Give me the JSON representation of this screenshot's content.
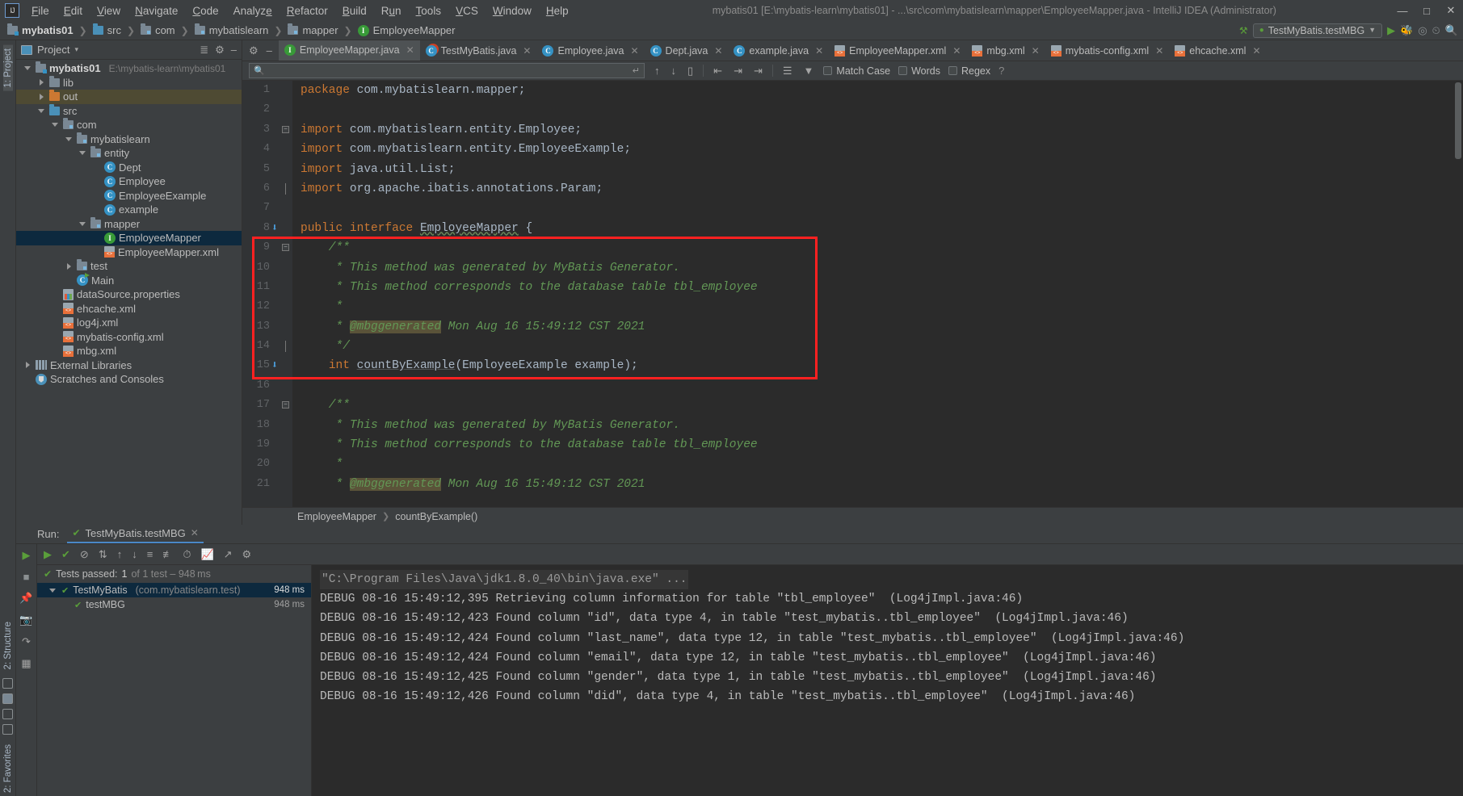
{
  "window": {
    "title": "mybatis01 [E:\\mybatis-learn\\mybatis01] - ...\\src\\com\\mybatislearn\\mapper\\EmployeeMapper.java - IntelliJ IDEA (Administrator)",
    "logo": "IJ",
    "minimize": "—",
    "maximize": "□",
    "close": "✕"
  },
  "menu": [
    {
      "label": "File"
    },
    {
      "label": "Edit"
    },
    {
      "label": "View"
    },
    {
      "label": "Navigate"
    },
    {
      "label": "Code"
    },
    {
      "label": "Analyze"
    },
    {
      "label": "Refactor"
    },
    {
      "label": "Build"
    },
    {
      "label": "Run"
    },
    {
      "label": "Tools"
    },
    {
      "label": "VCS"
    },
    {
      "label": "Window"
    },
    {
      "label": "Help"
    }
  ],
  "breadcrumb": [
    {
      "label": "mybatis01",
      "icon": "module-icon"
    },
    {
      "label": "src",
      "icon": "folder-icon"
    },
    {
      "label": "com",
      "icon": "package-icon"
    },
    {
      "label": "mybatislearn",
      "icon": "package-icon"
    },
    {
      "label": "mapper",
      "icon": "package-icon"
    },
    {
      "label": "EmployeeMapper",
      "icon": "interface-icon"
    }
  ],
  "navbar_right": {
    "run_config": "TestMyBatis.testMBG",
    "run_icon": "run-icon",
    "debug_icon": "debug-icon",
    "coverage_icon": "coverage-icon",
    "profile_icon": "profile-icon",
    "search_icon": "search-everywhere-icon",
    "hammer_icon": "build-icon"
  },
  "project_panel": {
    "title": "Project",
    "chevron": "▾",
    "collapse_icon": "collapse-all-icon",
    "settings_icon": "gear-icon",
    "hide_icon": "hide-icon",
    "tree": [
      {
        "label": "mybatis01",
        "path": "E:\\mybatis-learn\\mybatis01",
        "icon": "module-icon",
        "indent": 0,
        "twisty": "down",
        "bold": true
      },
      {
        "label": "lib",
        "icon": "folder-icon",
        "indent": 1,
        "twisty": "right"
      },
      {
        "label": "out",
        "icon": "folder-orange-icon",
        "indent": 1,
        "twisty": "right",
        "highlight": true
      },
      {
        "label": "src",
        "icon": "folder-blue-icon",
        "indent": 1,
        "twisty": "down"
      },
      {
        "label": "com",
        "icon": "package-icon",
        "indent": 2,
        "twisty": "down"
      },
      {
        "label": "mybatislearn",
        "icon": "package-icon",
        "indent": 3,
        "twisty": "down"
      },
      {
        "label": "entity",
        "icon": "package-icon",
        "indent": 4,
        "twisty": "down"
      },
      {
        "label": "Dept",
        "icon": "class-icon",
        "indent": 5,
        "twisty": ""
      },
      {
        "label": "Employee",
        "icon": "class-icon",
        "indent": 5,
        "twisty": ""
      },
      {
        "label": "EmployeeExample",
        "icon": "class-icon",
        "indent": 5,
        "twisty": ""
      },
      {
        "label": "example",
        "icon": "class-icon",
        "indent": 5,
        "twisty": ""
      },
      {
        "label": "mapper",
        "icon": "package-icon",
        "indent": 4,
        "twisty": "down"
      },
      {
        "label": "EmployeeMapper",
        "icon": "interface-icon",
        "indent": 5,
        "twisty": "",
        "selected": true
      },
      {
        "label": "EmployeeMapper.xml",
        "icon": "xml-icon",
        "indent": 5,
        "twisty": ""
      },
      {
        "label": "test",
        "icon": "package-icon",
        "indent": 3,
        "twisty": "right"
      },
      {
        "label": "Main",
        "icon": "runnable-class-icon",
        "indent": 3,
        "twisty": ""
      },
      {
        "label": "dataSource.properties",
        "icon": "properties-icon",
        "indent": 2,
        "twisty": ""
      },
      {
        "label": "ehcache.xml",
        "icon": "xml-icon",
        "indent": 2,
        "twisty": ""
      },
      {
        "label": "log4j.xml",
        "icon": "xml-icon",
        "indent": 2,
        "twisty": ""
      },
      {
        "label": "mybatis-config.xml",
        "icon": "xml-icon",
        "indent": 2,
        "twisty": ""
      },
      {
        "label": "mbg.xml",
        "icon": "xml-icon",
        "indent": 2,
        "twisty": ""
      },
      {
        "label": "External Libraries",
        "icon": "library-icon",
        "indent": 0,
        "twisty": "right"
      },
      {
        "label": "Scratches and Consoles",
        "icon": "scratches-icon",
        "indent": 0,
        "twisty": ""
      }
    ]
  },
  "editor_tabs": [
    {
      "label": "EmployeeMapper.java",
      "icon": "interface-icon",
      "active": true,
      "close": "✕"
    },
    {
      "label": "TestMyBatis.java",
      "icon": "test-class-icon",
      "active": false,
      "close": "✕"
    },
    {
      "label": "Employee.java",
      "icon": "class-icon",
      "active": false,
      "close": "✕"
    },
    {
      "label": "Dept.java",
      "icon": "class-icon",
      "active": false,
      "close": "✕"
    },
    {
      "label": "example.java",
      "icon": "class-icon",
      "active": false,
      "close": "✕"
    },
    {
      "label": "EmployeeMapper.xml",
      "icon": "xml-icon",
      "active": false,
      "close": "✕"
    },
    {
      "label": "mbg.xml",
      "icon": "xml-icon",
      "active": false,
      "close": "✕"
    },
    {
      "label": "mybatis-config.xml",
      "icon": "xml-icon",
      "active": false,
      "close": "✕"
    },
    {
      "label": "ehcache.xml",
      "icon": "xml-icon",
      "active": false,
      "close": "✕"
    }
  ],
  "find_bar": {
    "placeholder": "",
    "value": "",
    "search_icon": "search-icon",
    "return_icon": "return-icon",
    "prev_icon": "previous-occurrence-icon",
    "next_icon": "next-occurrence-icon",
    "select_all_icon": "select-all-occurrences-icon",
    "filter_icon": "filter-icon",
    "options_icon": "find-options-icon",
    "match_case": "Match Case",
    "words": "Words",
    "regex": "Regex",
    "help": "?"
  },
  "editor": {
    "lines": [
      {
        "n": "1",
        "fold": "",
        "marker": ""
      },
      {
        "n": "2",
        "fold": "",
        "marker": ""
      },
      {
        "n": "3",
        "fold": "minus",
        "marker": ""
      },
      {
        "n": "4",
        "fold": "",
        "marker": ""
      },
      {
        "n": "5",
        "fold": "",
        "marker": ""
      },
      {
        "n": "6",
        "fold": "end",
        "marker": ""
      },
      {
        "n": "7",
        "fold": "",
        "marker": ""
      },
      {
        "n": "8",
        "fold": "",
        "marker": "implemented"
      },
      {
        "n": "9",
        "fold": "minus",
        "marker": ""
      },
      {
        "n": "10",
        "fold": "",
        "marker": ""
      },
      {
        "n": "11",
        "fold": "",
        "marker": ""
      },
      {
        "n": "12",
        "fold": "",
        "marker": ""
      },
      {
        "n": "13",
        "fold": "",
        "marker": ""
      },
      {
        "n": "14",
        "fold": "end",
        "marker": ""
      },
      {
        "n": "15",
        "fold": "",
        "marker": "implemented"
      },
      {
        "n": "16",
        "fold": "",
        "marker": ""
      },
      {
        "n": "17",
        "fold": "minus",
        "marker": ""
      },
      {
        "n": "18",
        "fold": "",
        "marker": ""
      },
      {
        "n": "19",
        "fold": "",
        "marker": ""
      },
      {
        "n": "20",
        "fold": "",
        "marker": ""
      },
      {
        "n": "21",
        "fold": "",
        "marker": ""
      }
    ],
    "code": [
      "package com.mybatislearn.mapper;",
      "",
      "import com.mybatislearn.entity.Employee;",
      "import com.mybatislearn.entity.EmployeeExample;",
      "import java.util.List;",
      "import org.apache.ibatis.annotations.Param;",
      "",
      "public interface EmployeeMapper {",
      "    /**",
      "     * This method was generated by MyBatis Generator.",
      "     * This method corresponds to the database table tbl_employee",
      "     *",
      "     * @mbggenerated Mon Aug 16 15:49:12 CST 2021",
      "     */",
      "    int countByExample(EmployeeExample example);",
      "",
      "    /**",
      "     * This method was generated by MyBatis Generator.",
      "     * This method corresponds to the database table tbl_employee",
      "     *",
      "     * @mbggenerated Mon Aug 16 15:49:12 CST 2021"
    ],
    "annotation_tag": "@mbggenerated",
    "highlight_color": "#ff2121",
    "breadcrumb": [
      "EmployeeMapper",
      "countByExample()"
    ]
  },
  "run_window": {
    "label": "Run:",
    "tab": "TestMyBatis.testMBG",
    "tab_icon": "test-passed-icon",
    "tab_close": "✕",
    "toolbar_left": [
      "rerun-icon",
      "rerun-failed-icon",
      "stop-icon",
      "screenshot-icon",
      "camera-icon",
      "export-icon",
      "layout-icon"
    ],
    "toolbar_top": [
      "rerun-tests-icon",
      "toggle-passed-icon",
      "ignore-icon",
      "sort-alpha-icon",
      "sort-duration-icon",
      "expand-all-icon",
      "collapse-all-icon",
      "clock-icon",
      "chart-icon",
      "export-icon",
      "settings-icon"
    ],
    "status": {
      "check": "✔",
      "prefix": "Tests passed:",
      "count": "1",
      "suffix": "of 1 test – 948 ms"
    },
    "tree": [
      {
        "label": "TestMyBatis",
        "sub": "(com.mybatislearn.test)",
        "time": "948 ms",
        "indent": 0,
        "twisty": "down",
        "selected": true,
        "icon": "test-passed-icon"
      },
      {
        "label": "testMBG",
        "sub": "",
        "time": "948 ms",
        "indent": 1,
        "twisty": "",
        "selected": false,
        "icon": "test-passed-icon"
      }
    ],
    "console": [
      {
        "text": "\"C:\\Program Files\\Java\\jdk1.8.0_40\\bin\\java.exe\" ...",
        "type": "cmd"
      },
      {
        "text": "DEBUG 08-16 15:49:12,395 Retrieving column information for table \"tbl_employee\"  (Log4jImpl.java:46)",
        "type": "log"
      },
      {
        "text": "DEBUG 08-16 15:49:12,423 Found column \"id\", data type 4, in table \"test_mybatis..tbl_employee\"  (Log4jImpl.java:46)",
        "type": "log"
      },
      {
        "text": "DEBUG 08-16 15:49:12,424 Found column \"last_name\", data type 12, in table \"test_mybatis..tbl_employee\"  (Log4jImpl.java:46)",
        "type": "log"
      },
      {
        "text": "DEBUG 08-16 15:49:12,424 Found column \"email\", data type 12, in table \"test_mybatis..tbl_employee\"  (Log4jImpl.java:46)",
        "type": "log"
      },
      {
        "text": "DEBUG 08-16 15:49:12,425 Found column \"gender\", data type 1, in table \"test_mybatis..tbl_employee\"  (Log4jImpl.java:46)",
        "type": "log"
      },
      {
        "text": "DEBUG 08-16 15:49:12,426 Found column \"did\", data type 4, in table \"test_mybatis..tbl_employee\"  (Log4jImpl.java:46)",
        "type": "log"
      }
    ]
  },
  "left_strip": {
    "project_label": "1: Project",
    "structure_label": "2: Structure",
    "favorites_label": "2: Favorites"
  }
}
